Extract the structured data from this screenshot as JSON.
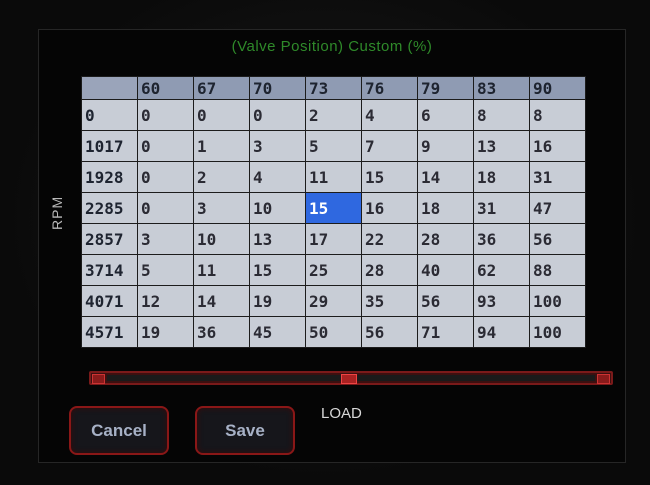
{
  "title": "(Valve Position) Custom (%)",
  "y_axis_label": "RPM",
  "x_axis_label": "LOAD",
  "columns": [
    "60",
    "67",
    "70",
    "73",
    "76",
    "79",
    "83",
    "90"
  ],
  "rows": [
    {
      "rpm": "0",
      "values": [
        "0",
        "0",
        "0",
        "2",
        "4",
        "6",
        "8",
        "8"
      ]
    },
    {
      "rpm": "1017",
      "values": [
        "0",
        "1",
        "3",
        "5",
        "7",
        "9",
        "13",
        "16"
      ]
    },
    {
      "rpm": "1928",
      "values": [
        "0",
        "2",
        "4",
        "11",
        "15",
        "14",
        "18",
        "31"
      ]
    },
    {
      "rpm": "2285",
      "values": [
        "0",
        "3",
        "10",
        "15",
        "16",
        "18",
        "31",
        "47"
      ]
    },
    {
      "rpm": "2857",
      "values": [
        "3",
        "10",
        "13",
        "17",
        "22",
        "28",
        "36",
        "56"
      ]
    },
    {
      "rpm": "3714",
      "values": [
        "5",
        "11",
        "15",
        "25",
        "28",
        "40",
        "62",
        "88"
      ]
    },
    {
      "rpm": "4071",
      "values": [
        "12",
        "14",
        "19",
        "29",
        "35",
        "56",
        "93",
        "100"
      ]
    },
    {
      "rpm": "4571",
      "values": [
        "19",
        "36",
        "45",
        "50",
        "56",
        "71",
        "94",
        "100"
      ]
    }
  ],
  "selected_cell": {
    "row": 3,
    "col": 3
  },
  "buttons": {
    "cancel": "Cancel",
    "save": "Save"
  },
  "colors": {
    "title": "#2f8a2a",
    "selected": "#2f68e0",
    "button_border": "#8a1717",
    "header": "#8f9bb3"
  }
}
